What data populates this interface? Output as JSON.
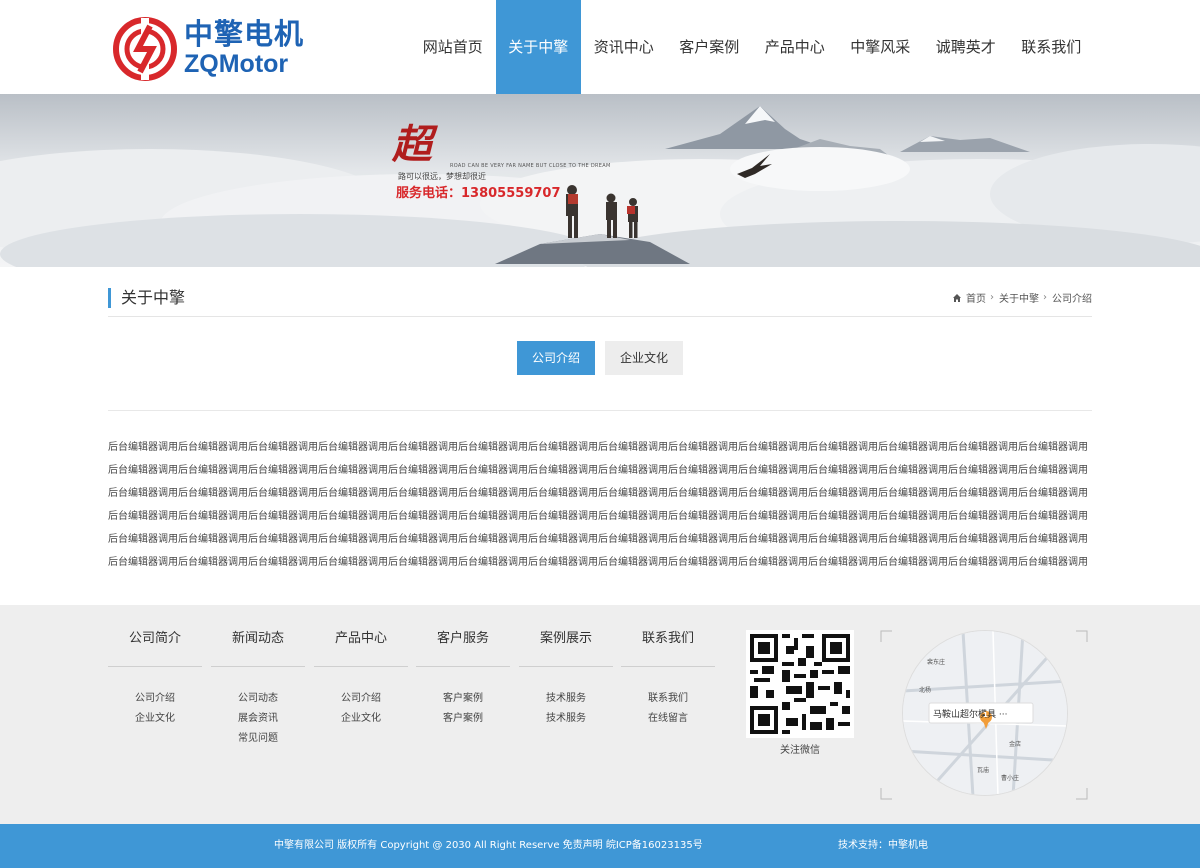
{
  "header": {
    "logo_cn": "中擎电机",
    "logo_en": "ZQMotor",
    "nav": [
      {
        "label": "网站首页",
        "active": false
      },
      {
        "label": "关于中擎",
        "active": true
      },
      {
        "label": "资讯中心",
        "active": false
      },
      {
        "label": "客户案例",
        "active": false
      },
      {
        "label": "产品中心",
        "active": false
      },
      {
        "label": "中擎风采",
        "active": false
      },
      {
        "label": "诚聘英才",
        "active": false
      },
      {
        "label": "联系我们",
        "active": false
      }
    ]
  },
  "banner": {
    "big_char": "超",
    "english_line": "ROAD CAN BE VERY FAR NAME BUT CLOSE TO THE DREAM",
    "slogan": "路可以很远，梦想却很近",
    "phone": "服务电话：13805559707"
  },
  "section": {
    "title": "关于中擎",
    "breadcrumb": [
      "首页",
      "关于中擎",
      "公司介绍"
    ]
  },
  "tabs": [
    {
      "label": "公司介绍",
      "active": true
    },
    {
      "label": "企业文化",
      "active": false
    }
  ],
  "content": {
    "body": "后台编辑器调用后台编辑器调用后台编辑器调用后台编辑器调用后台编辑器调用后台编辑器调用后台编辑器调用后台编辑器调用后台编辑器调用后台编辑器调用后台编辑器调用后台编辑器调用后台编辑器调用后台编辑器调用后台编辑器调用后台编辑器调用后台编辑器调用后台编辑器调用后台编辑器调用后台编辑器调用后台编辑器调用后台编辑器调用后台编辑器调用后台编辑器调用后台编辑器调用后台编辑器调用后台编辑器调用后台编辑器调用后台编辑器调用后台编辑器调用后台编辑器调用后台编辑器调用后台编辑器调用后台编辑器调用后台编辑器调用后台编辑器调用后台编辑器调用后台编辑器调用后台编辑器调用后台编辑器调用后台编辑器调用后台编辑器调用后台编辑器调用后台编辑器调用后台编辑器调用后台编辑器调用后台编辑器调用后台编辑器调用后台编辑器调用后台编辑器调用后台编辑器调用后台编辑器调用后台编辑器调用后台编辑器调用后台编辑器调用后台编辑器调用后台编辑器调用后台编辑器调用后台编辑器调用后台编辑器调用后台编辑器调用后台编辑器调用后台编辑器调用后台编辑器调用后台编辑器调用后台编辑器调用后台编辑器调用后台编辑器调用后台编辑器调用后台编辑器调用后台编辑器调用后台编辑器调用后台编辑器调用后台编辑器调用后台编辑器调用后台编辑器调用后台编辑器调用后台编辑器调用后台编辑器调用后台编辑器调用后台编辑器调用后台编辑器调用后台编辑器调用后台编辑器调用后台编辑器调用后台编辑器调用后台编辑器调用后台编辑器调用后台编辑器调用后台编辑器调用后台编辑器调用后台编辑器调用"
  },
  "footer": {
    "columns": [
      {
        "title": "公司简介",
        "links": [
          "公司介绍",
          "企业文化"
        ]
      },
      {
        "title": "新闻动态",
        "links": [
          "公司动态",
          "展会资讯",
          "常见问题"
        ]
      },
      {
        "title": "产品中心",
        "links": [
          "公司介绍",
          "企业文化"
        ]
      },
      {
        "title": "客户服务",
        "links": [
          "客户案例",
          "客户案例"
        ]
      },
      {
        "title": "案例展示",
        "links": [
          "技术服务",
          "技术服务"
        ]
      },
      {
        "title": "联系我们",
        "links": [
          "联系我们",
          "在线留言"
        ]
      }
    ],
    "qr_label": "关注微信",
    "map": {
      "place": "马鞍山超尔模具 ···",
      "pin": "1",
      "labels": [
        "裴东庄",
        "北杨",
        "金店",
        "瓦庙",
        "曹小庄"
      ]
    }
  },
  "bottom": {
    "copyright": "中擎有限公司 版权所有 Copyright @ 2030 All Right Reserve 免责声明 皖ICP备16023135号",
    "support": "技术支持：中擎机电"
  },
  "colors": {
    "accent": "#3f97d6",
    "logo_red": "#d8282b",
    "logo_blue": "#1e63b4"
  }
}
